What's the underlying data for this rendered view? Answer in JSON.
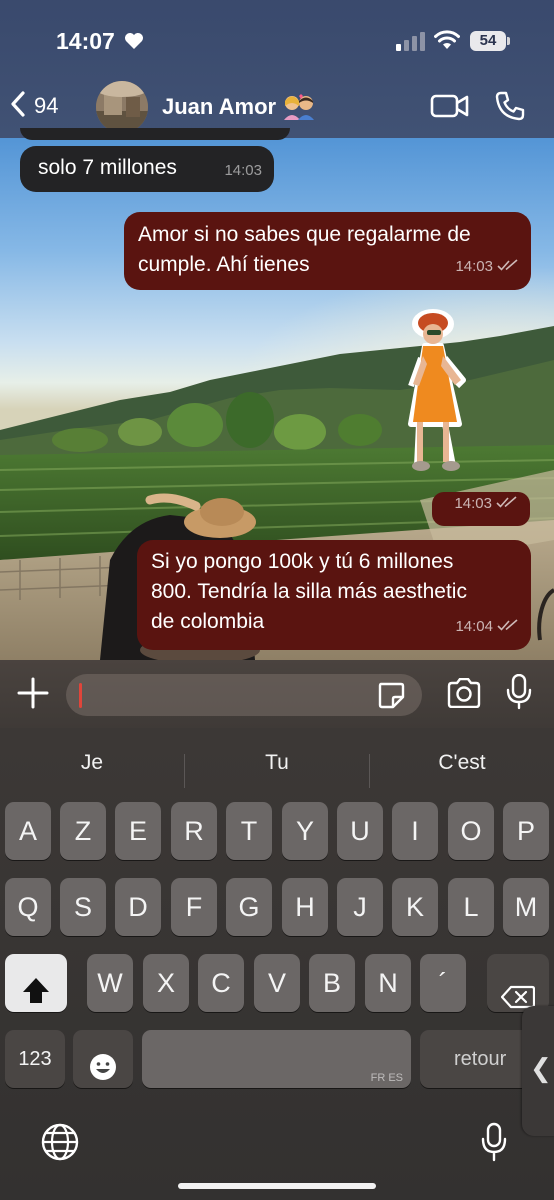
{
  "status_bar": {
    "time": "14:07",
    "battery": "54"
  },
  "header": {
    "back_count": "94",
    "contact_name": "Juan Amor"
  },
  "messages": [
    {
      "direction": "incoming",
      "text": "solo 7 millones",
      "time": "14:03"
    },
    {
      "direction": "outgoing",
      "lines": [
        "Amor si no sabes que regalarme de",
        "cumple. Ahí tienes"
      ],
      "time": "14:03",
      "status": "read"
    },
    {
      "direction": "outgoing",
      "type": "sticker",
      "sticker": "girl-in-orange-dress-sticker",
      "time": "14:03",
      "status": "read"
    },
    {
      "direction": "outgoing",
      "lines": [
        "Si yo pongo 100k y tú 6 millones",
        "800. Tendría la silla más aesthetic",
        "de colombia"
      ],
      "time": "14:04",
      "status": "read"
    }
  ],
  "keyboard": {
    "suggestions": [
      "Je",
      "Tu",
      "C'est"
    ],
    "row1": [
      "A",
      "Z",
      "E",
      "R",
      "T",
      "Y",
      "U",
      "I",
      "O",
      "P"
    ],
    "row2": [
      "Q",
      "S",
      "D",
      "F",
      "G",
      "H",
      "J",
      "K",
      "L",
      "M"
    ],
    "row3": [
      "W",
      "X",
      "C",
      "V",
      "B",
      "N",
      "´"
    ],
    "numbers_label": "123",
    "space_language": "FR ES",
    "return_label": "retour"
  },
  "colors": {
    "outgoing_bubble": "#5a1410",
    "incoming_bubble": "#232325",
    "cursor": "#e0453a"
  }
}
